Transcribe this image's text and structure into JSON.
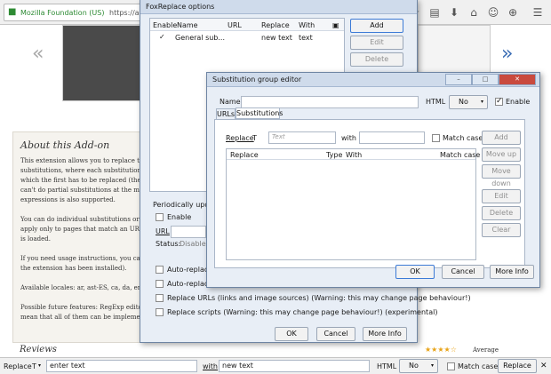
{
  "browser": {
    "org_label": "Mozilla Foundation (US)",
    "url": "https://adde"
  },
  "page": {
    "prev_arrow": "«",
    "next_arrow": "»",
    "about_title": "About this Add-on",
    "about_lines": [
      "This extension allows you to replace te",
      "substitutions, where each substitution",
      "which the first has to be replaced (the",
      "can't do partial substitutions at the m",
      "expressions is also supported.",
      "",
      "You can do individual substitutions or",
      "apply only to pages that match an URL",
      "is loaded.",
      "",
      "If you need usage instructions, you ca",
      "the extension has been installed).",
      "",
      "Available locales: ar, ast-ES, ca, da, en",
      "",
      "Possible future features: RegExp edito",
      "mean that all of them can be impleme"
    ],
    "reviews_title": "Reviews",
    "stars": "★★★★☆",
    "average_label": "Average"
  },
  "foxreplace": {
    "title": "FoxReplace options",
    "columns": [
      "Enable",
      "Name",
      "URL",
      "Replace",
      "With"
    ],
    "rows": [
      {
        "enabled": true,
        "name": "General sub...",
        "url": "",
        "replace": "new text",
        "with": "text"
      }
    ],
    "side_buttons": [
      "Add",
      "Edit",
      "Delete"
    ],
    "periodically_label": "Periodically update",
    "enable_label": "Enable",
    "url_label": "URL",
    "status_label": "Status:",
    "status_value": "Disabled",
    "options": [
      {
        "label": "Auto-replace on",
        "checked": false
      },
      {
        "label": "Auto-replace eve",
        "checked": false
      },
      {
        "label": "Replace URLs (links and image sources) (Warning: this may change page behaviour!)",
        "checked": false
      },
      {
        "label": "Replace scripts (Warning: this may change page behaviour!) (experimental)",
        "checked": false
      }
    ],
    "buttons": {
      "ok": "OK",
      "cancel": "Cancel",
      "more_info": "More Info"
    }
  },
  "editor": {
    "title": "Substitution group editor",
    "name_label": "Name",
    "name_value": "",
    "html_label": "HTML",
    "html_value": "No",
    "enable_label": "Enable",
    "enable_checked": true,
    "tabs": [
      "URLs",
      "Substitutions"
    ],
    "replace_label": "Replace",
    "replace_type": "T",
    "text_placeholder": "Text",
    "with_label": "with",
    "match_case_label": "Match case",
    "list_columns": [
      "Replace",
      "Type",
      "With",
      "Match case"
    ],
    "side_buttons": [
      {
        "label": "Add",
        "enabled": false
      },
      {
        "label": "Move up",
        "enabled": false
      },
      {
        "label": "Move down",
        "enabled": false
      },
      {
        "label": "Edit",
        "enabled": false
      },
      {
        "label": "Delete",
        "enabled": false
      },
      {
        "label": "Clear",
        "enabled": false
      }
    ],
    "buttons": {
      "ok": "OK",
      "cancel": "Cancel",
      "more_info": "More Info"
    }
  },
  "findbar": {
    "replace_label": "Replace",
    "type": "T",
    "replace_value": "enter text",
    "with_label": "with",
    "with_value": "new text",
    "html_label": "HTML",
    "html_value": "No",
    "match_case_label": "Match case",
    "replace_button": "Replace",
    "close": "✕"
  }
}
